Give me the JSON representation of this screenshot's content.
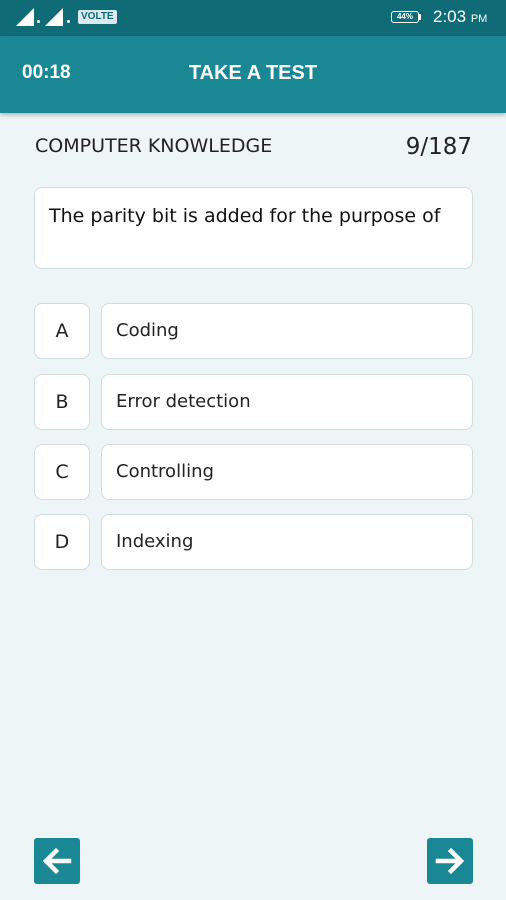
{
  "status_bar": {
    "network_badge": "VOLTE",
    "battery_percent": "44%",
    "time": "2:03",
    "time_suffix": "PM"
  },
  "app_bar": {
    "timer": "00:18",
    "title": "TAKE A TEST"
  },
  "quiz": {
    "subject": "COMPUTER KNOWLEDGE",
    "progress": "9/187",
    "question": "The parity bit is added for the purpose of",
    "options": [
      {
        "letter": "A",
        "text": "Coding"
      },
      {
        "letter": "B",
        "text": "Error detection"
      },
      {
        "letter": "C",
        "text": "Controlling"
      },
      {
        "letter": "D",
        "text": "Indexing"
      }
    ]
  },
  "navigation": {
    "prev_icon": "arrow-left-icon",
    "next_icon": "arrow-right-icon"
  },
  "colors": {
    "status_bar": "#0f6c77",
    "app_bar": "#1a8795",
    "background": "#eef5f7"
  }
}
